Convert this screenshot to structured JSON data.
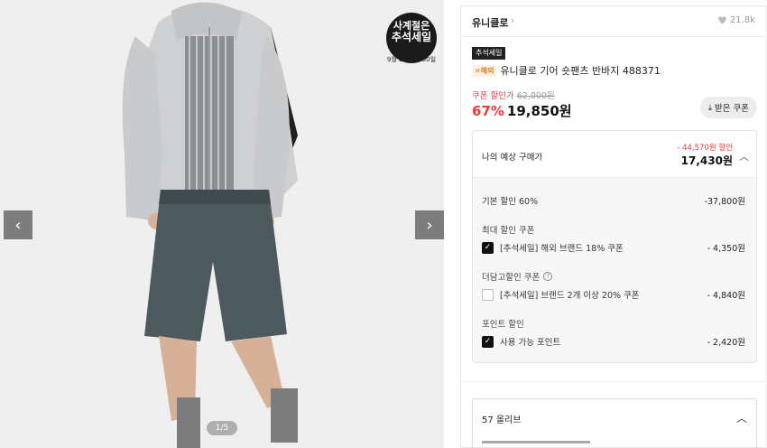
{
  "gallery": {
    "badge_line1": "사계절은",
    "badge_line2": "추석세일",
    "badge_line3": "9월 21일 ~ 30일",
    "prev_icon": "‹",
    "next_icon": "›",
    "pager": "1/5"
  },
  "brand": {
    "name": "유니클로",
    "chevron": "›",
    "likes": "21.8k"
  },
  "product": {
    "tag": "추석세일",
    "overseas": "✕해외",
    "title": "유니클로 기어 숏팬츠 반바지 488371"
  },
  "pricing": {
    "coupon_label": "쿠폰 할인가",
    "original_price": "62,000원",
    "discount_rate": "67%",
    "price": "19,850원",
    "coupon_button": "받은 쿠폰",
    "coupon_button_icon": "⤓"
  },
  "estimate": {
    "label": "나의 예상 구매가",
    "saving": "- 44,570원 할인",
    "price": "17,430원",
    "caret": "︿",
    "base_discount": {
      "label": "기본 할인 60%",
      "amount": "-37,800원"
    },
    "max_coupon": {
      "group": "최대 할인 쿠폰",
      "item": "[추석세일] 해외 브랜드 18% 쿠폰",
      "amount": "- 4,350원",
      "checked": true
    },
    "extra_coupon": {
      "group": "더담고할인 쿠폰",
      "item": "[추석세일] 브랜드 2개 이상 20% 쿠폰",
      "amount": "- 4,840원",
      "checked": false
    },
    "points": {
      "group": "포인트 할인",
      "item": "사용 가능 포인트",
      "amount": "- 2,420원",
      "checked": true
    }
  },
  "reviews": {
    "label": "57 올리브",
    "caret": "︿"
  },
  "colors": {
    "accent_red": "#f23a3a",
    "dark": "#111111"
  }
}
